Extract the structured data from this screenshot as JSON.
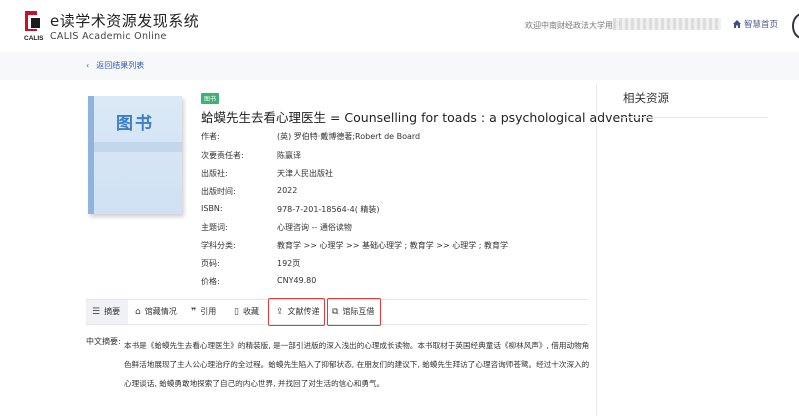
{
  "header": {
    "app_title": "e读学术资源发现系统",
    "app_subtitle": "CALIS Academic Online",
    "logo_text": "CALIS",
    "welcome": "欢迎中南财经政法大学用户",
    "home_label": "智慧首页"
  },
  "nav": {
    "back_label": "返回结果列表"
  },
  "book": {
    "cover_label": "图书",
    "type_badge": "图书",
    "title": "蛤蟆先生去看心理医生 = Counselling for toads : a psychological adventure",
    "fields": [
      {
        "label": "作者:",
        "value": "(英) 罗伯特·戴博德著;Robert de Board"
      },
      {
        "label": "次要责任者:",
        "value": "陈赢译"
      },
      {
        "label": "出版社:",
        "value": "天津人民出版社"
      },
      {
        "label": "出版时间:",
        "value": "2022"
      },
      {
        "label": "ISBN:",
        "value": "978-7-201-18564-4( 精装)"
      },
      {
        "label": "主题词:",
        "value": "心理咨询 -- 通俗读物"
      },
      {
        "label": "学科分类:",
        "value": "教育学 >> 心理学 >> 基础心理学 ; 教育学 >> 心理学 ; 教育学"
      },
      {
        "label": "页码:",
        "value": "192页"
      },
      {
        "label": "价格:",
        "value": "CNY49.80"
      }
    ]
  },
  "tabs": [
    {
      "label": "摘要",
      "icon": "list-icon"
    },
    {
      "label": "馆藏情况",
      "icon": "library-icon"
    },
    {
      "label": "引用",
      "icon": "quote-icon"
    },
    {
      "label": "收藏",
      "icon": "bookmark-icon"
    },
    {
      "label": "文献传递",
      "icon": "transfer-icon"
    },
    {
      "label": "馆际互借",
      "icon": "interlibrary-icon"
    }
  ],
  "abstract": {
    "label": "中文摘要:",
    "text": "本书是《蛤蟆先生去看心理医生》的精装版, 是一部引进版的深入浅出的心理成长读物。本书取材于英国经典童话《柳林风声》, 借用动物角色鲜活地展现了主人公心理治疗的全过程。蛤蟆先生陷入了抑郁状态, 在朋友们的建议下, 蛤蟆先生拜访了心理咨询师苍鹭。经过十次深入的心理谈话, 蛤蟆勇敢地探索了自己的内心世界, 并找回了对生活的信心和勇气。"
  },
  "sidebar": {
    "title": "相关资源"
  },
  "colors": {
    "accent": "#2f5bb7",
    "badge": "#3cb371",
    "highlight_border": "#e03a3a",
    "cover": "#3e7ec7"
  }
}
